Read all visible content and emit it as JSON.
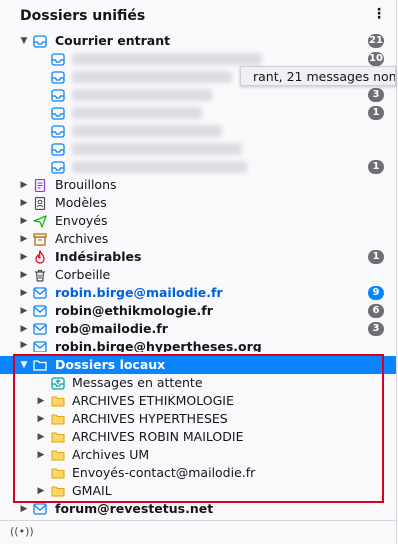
{
  "header": {
    "title": "Dossiers unifiés",
    "menu_icon": "kebab-icon"
  },
  "tooltip": {
    "text": "rant, 21 messages non"
  },
  "footer": {
    "status_icon": "wireless-signal-icon",
    "status_glyph": "((•))"
  },
  "colors": {
    "accent": "#0a84ff",
    "selection_box": "#d70022",
    "badge": "#6e6e73"
  },
  "rows": {
    "inbox": {
      "label": "Courrier entrant",
      "badge": "21"
    },
    "s1": {
      "badge": "10"
    },
    "s4": {
      "badge": "3"
    },
    "s5": {
      "badge": "1"
    },
    "s8": {
      "badge": "1"
    },
    "drafts": {
      "label": "Brouillons"
    },
    "templates": {
      "label": "Modèles"
    },
    "sent": {
      "label": "Envoyés"
    },
    "archives": {
      "label": "Archives"
    },
    "junk": {
      "label": "Indésirables",
      "badge": "1"
    },
    "trash": {
      "label": "Corbeille"
    },
    "acc1": {
      "label": "robin.birge@mailodie.fr",
      "badge": "9"
    },
    "acc2": {
      "label": "robin@ethikmologie.fr",
      "badge": "6"
    },
    "acc3": {
      "label": "rob@mailodie.fr",
      "badge": "3"
    },
    "acc4": {
      "label": "robin.birge@hypertheses.org"
    },
    "local": {
      "label": "Dossiers locaux"
    },
    "outbox": {
      "label": "Messages en attente"
    },
    "f1": {
      "label": "ARCHIVES ETHIKMOLOGIE"
    },
    "f2": {
      "label": "ARCHIVES HYPERTHESES"
    },
    "f3": {
      "label": "ARCHIVES ROBIN MAILODIE"
    },
    "f4": {
      "label": "Archives UM"
    },
    "f5": {
      "label": "Envoyés-contact@mailodie.fr"
    },
    "f6": {
      "label": "GMAIL"
    },
    "acc5": {
      "label": "forum@revestetus.net"
    }
  }
}
